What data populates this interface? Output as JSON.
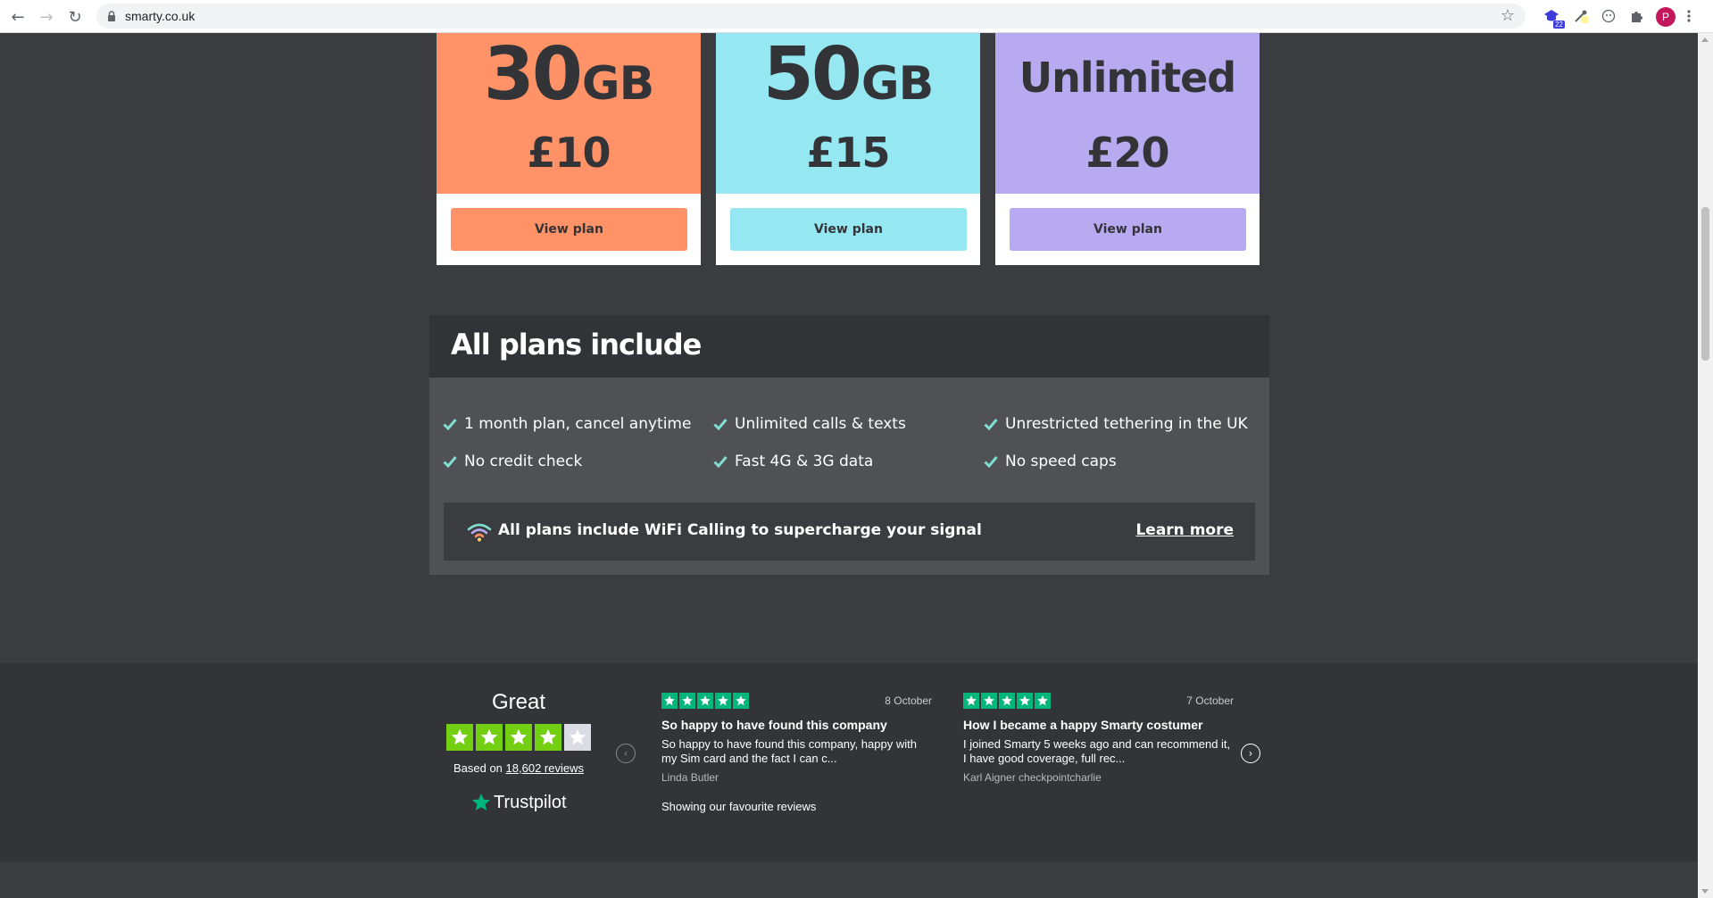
{
  "browser": {
    "url": "smarty.co.uk",
    "extension_badge": "22",
    "profile_initial": "P",
    "icons": [
      "back-icon",
      "forward-icon",
      "reload-icon",
      "lock-icon",
      "bookmark-star-icon",
      "extension-icon",
      "puzzle-icon",
      "menu-icon"
    ]
  },
  "plans": [
    {
      "data_amount": "30",
      "data_unit": "GB",
      "price": "£10",
      "button": "View plan",
      "color": "#ff9266"
    },
    {
      "data_amount": "50",
      "data_unit": "GB",
      "price": "£15",
      "button": "View plan",
      "color": "#95e8f2"
    },
    {
      "data_amount": "Unlimited",
      "data_unit": "",
      "price": "£20",
      "button": "View plan",
      "color": "#b7aaf0"
    }
  ],
  "includes": {
    "title": "All plans include",
    "features": [
      "1 month plan, cancel anytime",
      "Unlimited calls & texts",
      "Unrestricted tethering in the UK",
      "No credit check",
      "Fast 4G & 3G data",
      "No speed caps"
    ],
    "wifi_text": "All plans include WiFi Calling to supercharge your signal",
    "learn_more": "Learn more"
  },
  "trustpilot": {
    "rating_word": "Great",
    "stars_filled": 4,
    "stars_total": 5,
    "based_on": "Based on",
    "reviews_link": "18,602 reviews",
    "brand": "Trustpilot",
    "favourite_note": "Showing our favourite reviews",
    "reviews": [
      {
        "date": "8 October",
        "title": "So happy to have found this company",
        "body": "So happy to have found this company, happy with my Sim card and the fact I can c...",
        "author": "Linda Butler"
      },
      {
        "date": "7 October",
        "title": "How I became a happy Smarty costumer",
        "body": "I joined Smarty 5 weeks ago and can recommend it, I have good coverage, full rec...",
        "author": "Karl Aigner checkpointcharlie"
      }
    ]
  },
  "colors": {
    "page_bg": "#3b3c40",
    "header_bg": "#323337",
    "body_bg": "#505155",
    "check": "#7fe0d2",
    "trustpilot_green": "#00b67a",
    "trustpilot_rating_green": "#73cf11"
  }
}
